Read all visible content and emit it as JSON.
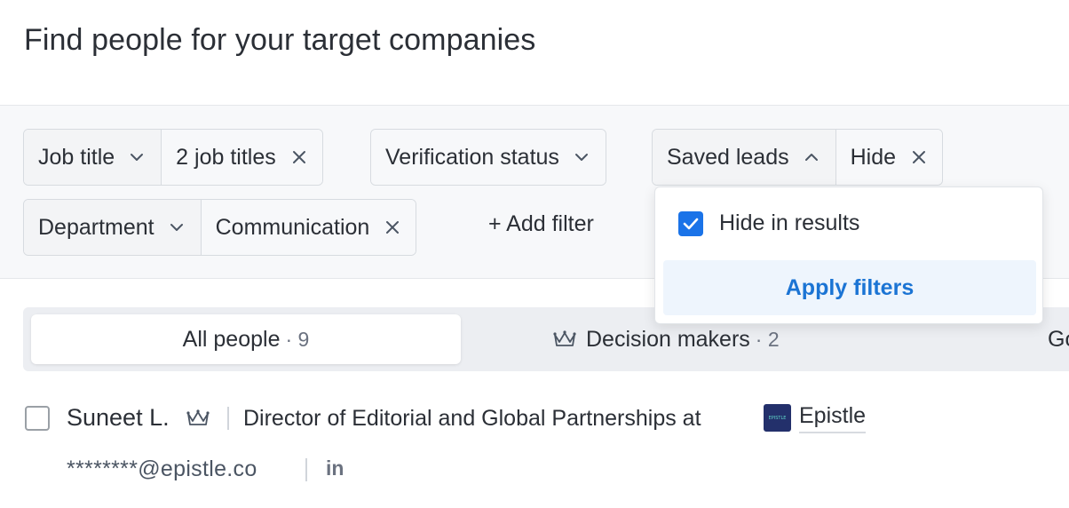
{
  "page": {
    "title": "Find people for your target companies"
  },
  "filters": {
    "job_title": {
      "label": "Job title",
      "value": "2 job titles"
    },
    "verification_status": {
      "label": "Verification status"
    },
    "saved_leads": {
      "label": "Saved leads",
      "value": "Hide"
    },
    "department": {
      "label": "Department",
      "value": "Communication"
    },
    "add_filter_label": "+ Add filter"
  },
  "saved_leads_dropdown": {
    "checkbox_label": "Hide in results",
    "checked": true,
    "apply_label": "Apply filters"
  },
  "tabs": [
    {
      "label": "All people",
      "count": "· 9"
    },
    {
      "label": "Decision makers",
      "count": "· 2"
    },
    {
      "label": "Go"
    }
  ],
  "results": [
    {
      "name": "Suneet L.",
      "role": "Director of Editorial and Global Partnerships at",
      "company": "Epistle",
      "company_logo_text": "EPISTLE",
      "email": "********@epistle.co",
      "linkedin_label": "in"
    }
  ],
  "colors": {
    "accent": "#1a73e8",
    "apply_text": "#1b74d4",
    "panel_bg": "#f7f8fa"
  }
}
